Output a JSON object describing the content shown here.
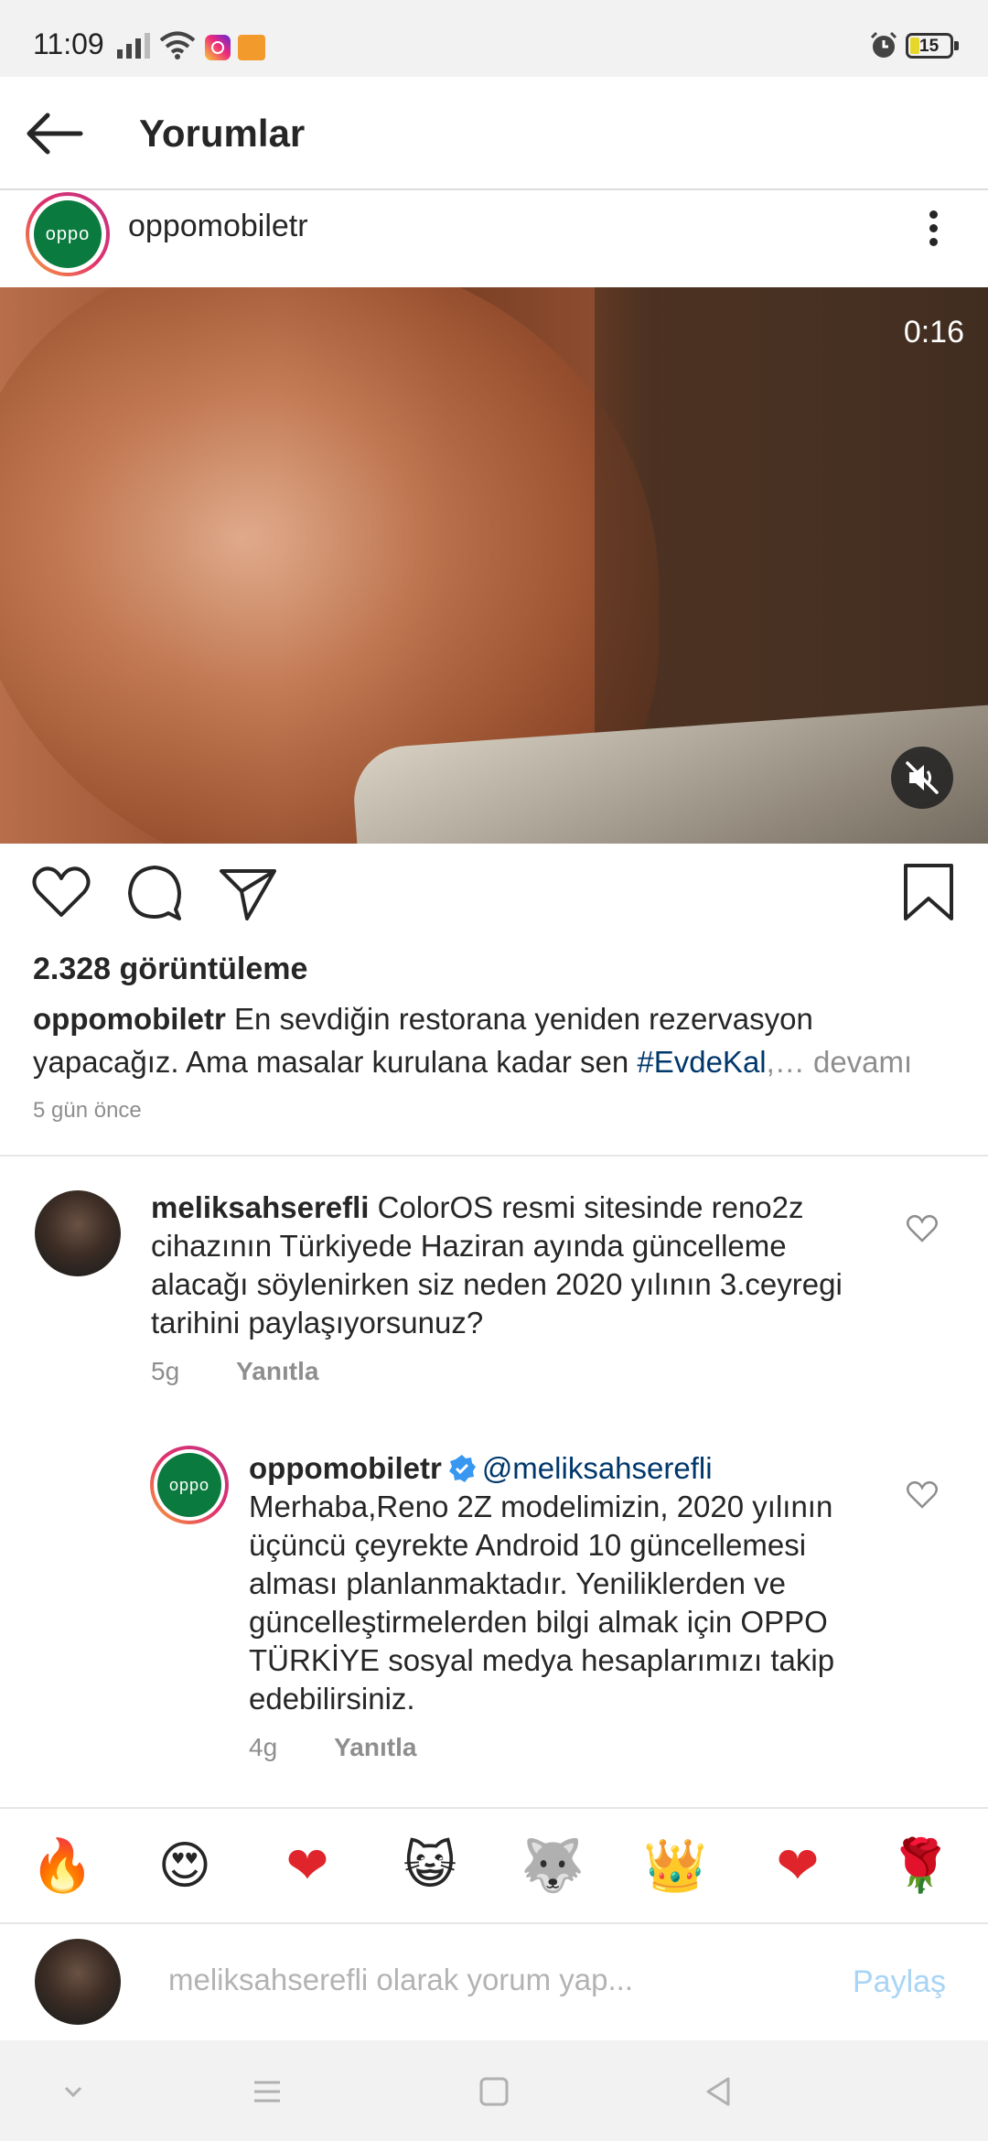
{
  "status_bar": {
    "time": "11:09",
    "battery": "15",
    "icons": [
      "signal-icon",
      "wifi-icon",
      "instagram-icon",
      "app-icon",
      "alarm-icon",
      "battery-icon"
    ]
  },
  "header": {
    "title": "Yorumlar",
    "back_icon": "back-arrow-icon"
  },
  "post": {
    "username": "oppomobiletr",
    "avatar_text": "oppo",
    "video_time": "0:16",
    "views": "2.328 görüntüleme",
    "caption_user": "oppomobiletr",
    "caption_text": " En sevdiğin restorana yeniden rezervasyon yapacağız. Ama masalar kurulana kadar sen ",
    "caption_tag": "#EvdeKal",
    "caption_more": ",… devamı",
    "age": "5 gün önce",
    "action_icons": [
      "heart-icon",
      "comment-icon",
      "share-icon",
      "bookmark-icon"
    ]
  },
  "comments": [
    {
      "username": "meliksahserefli",
      "text": " ColorOS resmi sitesinde reno2z cihazının Türkiyede Haziran ayında güncelleme alacağı söylenirken siz neden 2020 yılının 3.ceyregi tarihini paylaşıyorsunuz?",
      "age": "5g",
      "reply_label": "Yanıtla"
    },
    {
      "username": "oppomobiletr",
      "avatar_text": "oppo",
      "mention": "@meliksahserefli",
      "text": "Merhaba,Reno 2Z modelimizin, 2020 yılının üçüncü çeyrekte Android 10 güncellemesi alması planlanmaktadır. Yeniliklerden ve güncelleştirmelerden bilgi almak için OPPO TÜRKİYE sosyal medya hesaplarımızı takip edebilirsiniz.",
      "age": "4g",
      "reply_label": "Yanıtla"
    }
  ],
  "emojis": [
    "🔥",
    "😍",
    "❤",
    "😺",
    "🐺",
    "👑",
    "❤",
    "🌹"
  ],
  "composer": {
    "placeholder": "meliksahserefli olarak yorum yap...",
    "post_label": "Paylaş"
  },
  "colors": {
    "link": "#00376b",
    "secondary_text": "#8e8e8e",
    "post_button_disabled": "#a8d4f5",
    "oppo_green": "#0b7a3e"
  }
}
